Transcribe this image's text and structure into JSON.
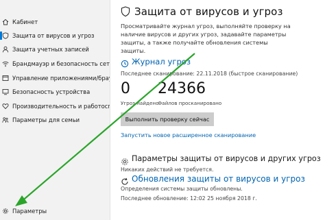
{
  "sidebar": {
    "items": [
      {
        "label": "Кабинет",
        "icon": "home-icon"
      },
      {
        "label": "Защита от вирусов и угроз",
        "icon": "shield-icon",
        "selected": true
      },
      {
        "label": "Защита учетных записей",
        "icon": "person-icon"
      },
      {
        "label": "Брандмауэр и безопасность сети",
        "icon": "wifi-icon"
      },
      {
        "label": "Управление приложениями/браузером",
        "icon": "app-window-icon"
      },
      {
        "label": "Безопасность устройства",
        "icon": "device-icon"
      },
      {
        "label": "Производительность и работоспособн",
        "icon": "heart-icon"
      },
      {
        "label": "Параметры для семьи",
        "icon": "family-icon"
      }
    ],
    "settings_label": "Параметры",
    "settings_icon": "gear-icon"
  },
  "main": {
    "title": "Защита от вирусов и угроз",
    "description": "Просматривайте журнал угроз, выполняйте проверку на наличие вирусов и других угроз, задавайте параметры защиты, а также получайте обновления системы защиты.",
    "threat_log": {
      "heading": "Журнал угроз",
      "last_scan": "Последнее сканирование: 22.11.2018 (быстрое сканирование)",
      "threats_found_value": "0",
      "threats_found_label": "Угроз найдено",
      "files_scanned_value": "24366",
      "files_scanned_label": "Файлов просканировано",
      "scan_button": "Выполнить проверку сейчас",
      "advanced_scan_link": "Запустить новое расширенное сканирование"
    },
    "protection_settings": {
      "heading": "Параметры защиты от вирусов и других угроз",
      "status": "Никаких действий не требуется."
    },
    "updates": {
      "heading": "Обновления защиты от вирусов и угроз",
      "definitions": "Определения системы защиты обновлены.",
      "last_update": "Последнее обновление: 12:02 25 ноября 2018 г."
    }
  },
  "colors": {
    "accent": "#0078d7",
    "link": "#0063b1",
    "arrow": "#2aa52a",
    "sidebar_bg": "#f2f2f2",
    "button_bg": "#cccccc"
  }
}
